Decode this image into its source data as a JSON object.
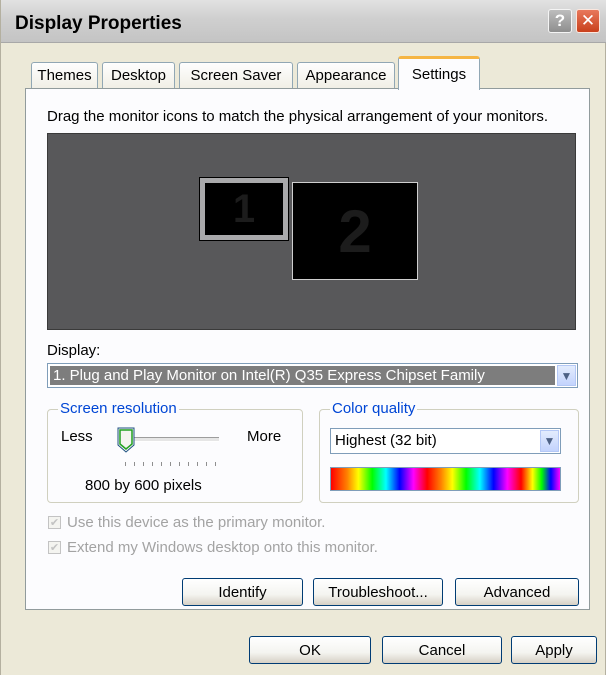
{
  "window": {
    "title": "Display Properties"
  },
  "tabs": [
    {
      "label": "Themes"
    },
    {
      "label": "Desktop"
    },
    {
      "label": "Screen Saver"
    },
    {
      "label": "Appearance"
    },
    {
      "label": "Settings",
      "active": true
    }
  ],
  "settings": {
    "instruction": "Drag the monitor icons to match the physical arrangement of your monitors.",
    "monitors": [
      {
        "number": "1"
      },
      {
        "number": "2"
      }
    ],
    "display_label": "Display:",
    "display_value": "1. Plug and Play Monitor on Intel(R) Q35 Express Chipset Family",
    "resolution": {
      "title": "Screen resolution",
      "less": "Less",
      "more": "More",
      "value_text": "800 by 600 pixels"
    },
    "color_quality": {
      "title": "Color quality",
      "value": "Highest (32 bit)"
    },
    "checkboxes": [
      {
        "label": "Use this device as the primary monitor.",
        "checked": true,
        "enabled": false
      },
      {
        "label": "Extend my Windows desktop onto this monitor.",
        "checked": true,
        "enabled": false
      }
    ],
    "buttons": {
      "identify": "Identify",
      "troubleshoot": "Troubleshoot...",
      "advanced": "Advanced"
    }
  },
  "dialog_buttons": {
    "ok": "OK",
    "cancel": "Cancel",
    "apply": "Apply"
  },
  "colors": {
    "group_title": "#0046d5",
    "active_tab_accent": "#f5b544",
    "display_selection": "#7d7d7d"
  },
  "icons": {
    "help": "help-icon",
    "close": "close-icon",
    "dropdown": "chevron-down-icon"
  }
}
